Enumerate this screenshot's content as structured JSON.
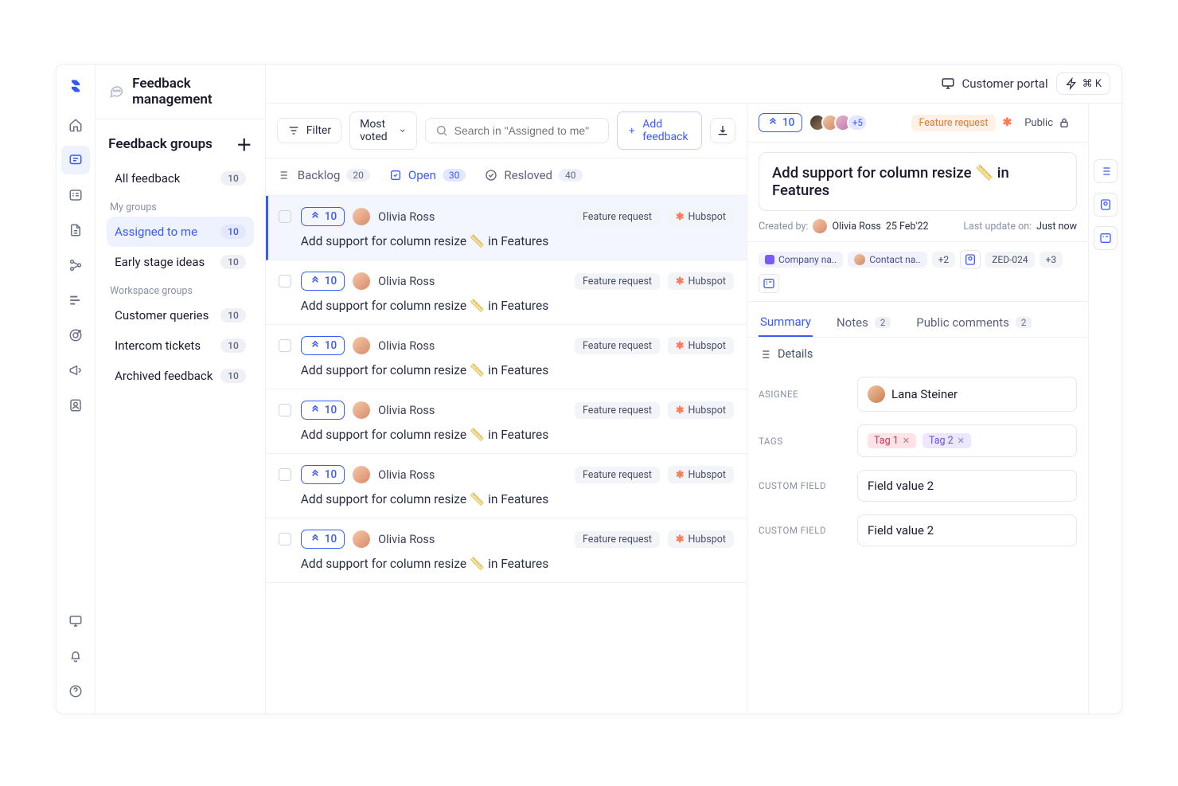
{
  "header": {
    "title": "Feedback management",
    "portal_label": "Customer portal",
    "cmdk": "⌘ K"
  },
  "sidebar": {
    "title": "Feedback groups",
    "all_label": "All feedback",
    "all_count": "10",
    "group1_label": "My groups",
    "group2_label": "Workspace groups",
    "items": [
      {
        "label": "Assigned to me",
        "count": "10"
      },
      {
        "label": "Early stage ideas",
        "count": "10"
      },
      {
        "label": "Customer queries",
        "count": "10"
      },
      {
        "label": "Intercom tickets",
        "count": "10"
      },
      {
        "label": "Archived feedback",
        "count": "10"
      }
    ]
  },
  "toolbar": {
    "filter_label": "Filter",
    "sort_label": "Most voted",
    "search_placeholder": "Search in \"Assigned to me\"",
    "add_feedback_label": "Add feedback"
  },
  "tabs": {
    "backlog": {
      "label": "Backlog",
      "count": "20"
    },
    "open": {
      "label": "Open",
      "count": "30"
    },
    "resolved": {
      "label": "Resloved",
      "count": "40"
    }
  },
  "cards": [
    {
      "votes": "10",
      "author": "Olivia Ross",
      "tag": "Feature request",
      "source": "Hubspot",
      "title_pre": "Add support for column resize ",
      "title_post": " in Features"
    },
    {
      "votes": "10",
      "author": "Olivia Ross",
      "tag": "Feature request",
      "source": "Hubspot",
      "title_pre": "Add support for column resize ",
      "title_post": " in Features"
    },
    {
      "votes": "10",
      "author": "Olivia Ross",
      "tag": "Feature request",
      "source": "Hubspot",
      "title_pre": "Add support for column resize ",
      "title_post": " in Features"
    },
    {
      "votes": "10",
      "author": "Olivia Ross",
      "tag": "Feature request",
      "source": "Hubspot",
      "title_pre": "Add support for column resize ",
      "title_post": " in Features"
    },
    {
      "votes": "10",
      "author": "Olivia Ross",
      "tag": "Feature request",
      "source": "Hubspot",
      "title_pre": "Add support for column resize ",
      "title_post": " in Features"
    },
    {
      "votes": "10",
      "author": "Olivia Ross",
      "tag": "Feature request",
      "source": "Hubspot",
      "title_pre": "Add support for column resize ",
      "title_post": " in Features"
    }
  ],
  "detail": {
    "votes": "10",
    "avatars_more": "+5",
    "feature_request": "Feature request",
    "public": "Public",
    "title_pre": "Add support for column resize ",
    "title_post": " in Features",
    "created_label": "Created by:",
    "created_by": "Olivia Ross",
    "created_date": "25 Feb'22",
    "updated_label": "Last update on:",
    "updated_value": "Just now",
    "chips": {
      "company": "Company na..",
      "contact": "Contact na..",
      "more_contacts": "+2",
      "zed": "ZED-024",
      "more_zed": "+3"
    },
    "tabs": {
      "summary": "Summary",
      "notes": "Notes",
      "notes_count": "2",
      "public_comments": "Public comments",
      "pc_count": "2"
    },
    "section_head": "Details",
    "fields": {
      "assignee_label": "ASIGNEE",
      "assignee_value": "Lana Steiner",
      "tags_label": "TAGS",
      "tag1": "Tag 1",
      "tag2": "Tag 2",
      "cf_label": "CUSTOM FIELD",
      "cf_value": "Field value 2"
    }
  }
}
